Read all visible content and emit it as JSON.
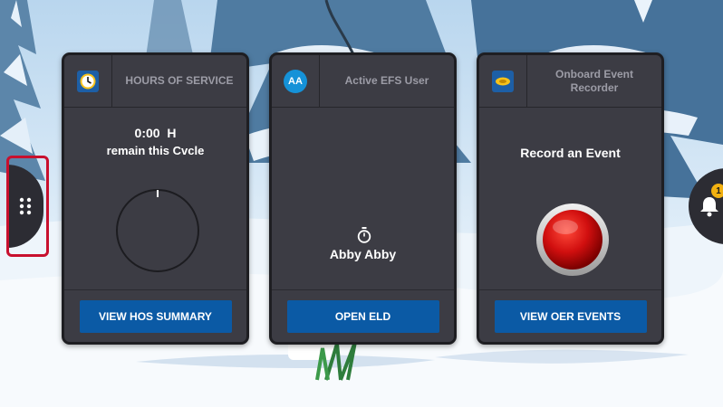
{
  "cards": [
    {
      "title": "HOURS OF SERVICE",
      "icon": "clock-icon",
      "hours_value": "0:00",
      "hours_unit": "H",
      "remain_text": "remain this Cvcle",
      "progress": 0,
      "button_label": "VIEW HOS SUMMARY"
    },
    {
      "title": "Active EFS User",
      "icon": "user-avatar",
      "avatar_initials": "AA",
      "timer_icon": "stopwatch-icon",
      "user_name": "Abby Abby",
      "button_label": "OPEN ELD"
    },
    {
      "title": "Onboard Event Recorder",
      "icon": "recorder-icon",
      "headline": "Record an Event",
      "record_button_icon": "red-record-button",
      "button_label": "VIEW OER EVENTS"
    }
  ],
  "side_menu": {
    "icon": "grid-dots-icon"
  },
  "notifications": {
    "icon": "bell-icon",
    "badge_count": "1"
  },
  "colors": {
    "card_bg": "#3c3c44",
    "button_blue": "#0b5aa5",
    "badge_yellow": "#f2b111",
    "highlight_red": "#c8102e",
    "record_red": "#d10f0f"
  }
}
